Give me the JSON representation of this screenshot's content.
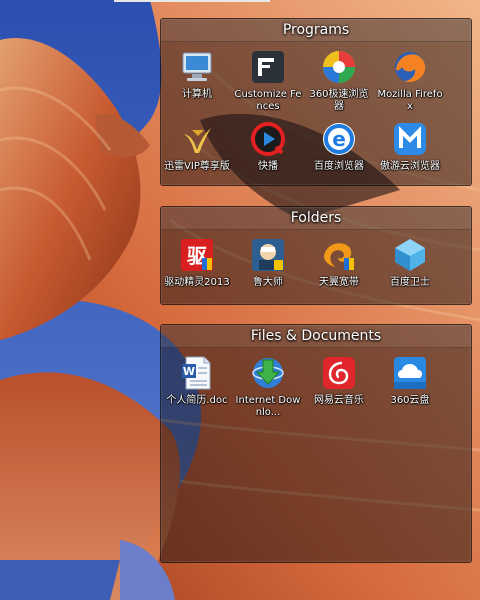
{
  "fences": {
    "programs": {
      "title": "Programs",
      "items": [
        {
          "label": "计算机",
          "icon": "computer-icon"
        },
        {
          "label": "Customize Fences",
          "icon": "fences-icon"
        },
        {
          "label": "360极速浏览器",
          "icon": "360-browser-icon"
        },
        {
          "label": "Mozilla Firefox",
          "icon": "firefox-icon"
        },
        {
          "label": "迅雷VIP尊享版",
          "icon": "thunder-icon"
        },
        {
          "label": "快播",
          "icon": "qvod-icon"
        },
        {
          "label": "百度浏览器",
          "icon": "baidu-browser-icon"
        },
        {
          "label": "傲游云浏览器",
          "icon": "maxthon-icon"
        }
      ]
    },
    "folders": {
      "title": "Folders",
      "items": [
        {
          "label": "驱动精灵2013",
          "icon": "drivergenius-icon"
        },
        {
          "label": "鲁大师",
          "icon": "ludashi-icon"
        },
        {
          "label": "天翼宽带",
          "icon": "tianyi-icon"
        },
        {
          "label": "百度卫士",
          "icon": "baidu-guard-icon"
        }
      ]
    },
    "files": {
      "title": "Files & Documents",
      "items": [
        {
          "label": "个人简历.doc",
          "icon": "word-doc-icon"
        },
        {
          "label": "Internet Downlo...",
          "icon": "idm-icon"
        },
        {
          "label": "网易云音乐",
          "icon": "netease-music-icon"
        },
        {
          "label": "360云盘",
          "icon": "360-cloud-icon"
        }
      ]
    }
  },
  "colors": {
    "fence_bg": "#191214",
    "sky": "#3a5bb8",
    "rock": "#d2643a"
  }
}
